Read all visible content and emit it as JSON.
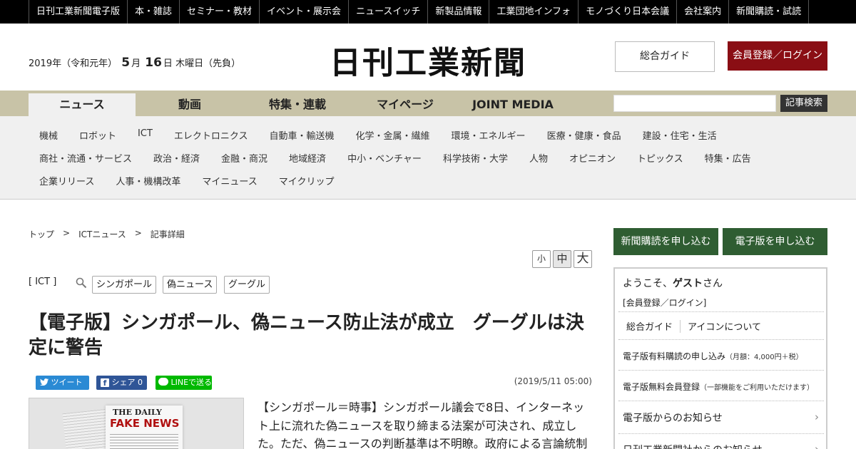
{
  "topnav": [
    "日刊工業新聞電子版",
    "本・雑誌",
    "セミナー・教材",
    "イベント・展示会",
    "ニュースイッチ",
    "新製品情報",
    "工業団地インフォ",
    "モノづくり日本会議",
    "会社案内",
    "新聞購読・試読"
  ],
  "header": {
    "date_year": "2019年（令和元年）",
    "date_month": "5",
    "month_unit": "月",
    "date_day": "16",
    "day_unit": "日",
    "date_weekday": "木曜日（先負）",
    "logo": "日刊工業新聞",
    "guide_button": "総合ガイド",
    "login_button": "会員登録／ログイン"
  },
  "mainnav": {
    "tabs": [
      "ニュース",
      "動画",
      "特集・連載",
      "マイページ",
      "JOINT MEDIA"
    ],
    "active_tab": "ニュース",
    "search_button": "記事検索"
  },
  "categories": {
    "row1": [
      "機械",
      "ロボット",
      "ICT",
      "エレクトロニクス",
      "自動車・輸送機",
      "化学・金属・繊維",
      "環境・エネルギー",
      "医療・健康・食品",
      "建設・住宅・生活"
    ],
    "row2": [
      "商社・流通・サービス",
      "政治・経済",
      "金融・商況",
      "地域経済",
      "中小・ベンチャー",
      "科学技術・大学",
      "人物",
      "オピニオン",
      "トピックス",
      "特集・広告"
    ],
    "row3": [
      "企業リリース",
      "人事・機構改革",
      "マイニュース",
      "マイクリップ"
    ]
  },
  "breadcrumb": [
    "トップ",
    "ICTニュース",
    "記事詳細"
  ],
  "breadcrumb_separator": ">",
  "font_sizes": [
    "小",
    "中",
    "大"
  ],
  "article": {
    "category": "[ ICT ]",
    "tags": [
      "シンガポール",
      "偽ニュース",
      "グーグル"
    ],
    "headline": "【電子版】シンガポール、偽ニュース防止法が成立　グーグルは決定に警告",
    "share": {
      "tweet": "ツイート",
      "facebook": "シェア",
      "facebook_count": "0",
      "line": "LINEで送る"
    },
    "published": "(2019/5/11 05:00)",
    "photo_text": {
      "small": "THE DAILY",
      "big": "FAKE NEWS"
    },
    "body": "【シンガポール＝時事】シンガポール議会で8日、インターネット上に流れた偽ニュースを取り締まる法案が可決され、成立した。ただ、偽ニュースの判断基準は不明瞭。政府による言論統制"
  },
  "sidebar": {
    "subscribe_paper": "新聞購読を申し込む",
    "subscribe_digital": "電子版を申し込む",
    "welcome_prefix": "ようこそ、",
    "welcome_name": "ゲスト",
    "welcome_suffix": "さん",
    "login_link": "[会員登録／ログイン]",
    "guide": "総合ガイド",
    "icons_about": "アイコンについて",
    "paid_subscription": "電子版有料購読の申し込み",
    "paid_note": "（月額：4,000円＋税）",
    "free_membership": "電子版無料会員登録",
    "free_note": "（一部機能をご利用いただけます）",
    "notice_digital": "電子版からのお知らせ",
    "notice_company": "日刊工業新聞社からのお知らせ"
  },
  "colors": {
    "topbar": "#000000",
    "login_button": "#8a0e14",
    "mainnav": "#c8c3a7",
    "category_bg": "#f0f0f0",
    "sidebar_button": "#2f5d32",
    "twitter": "#2a8ad4",
    "facebook": "#2f5597",
    "line": "#00b900"
  }
}
